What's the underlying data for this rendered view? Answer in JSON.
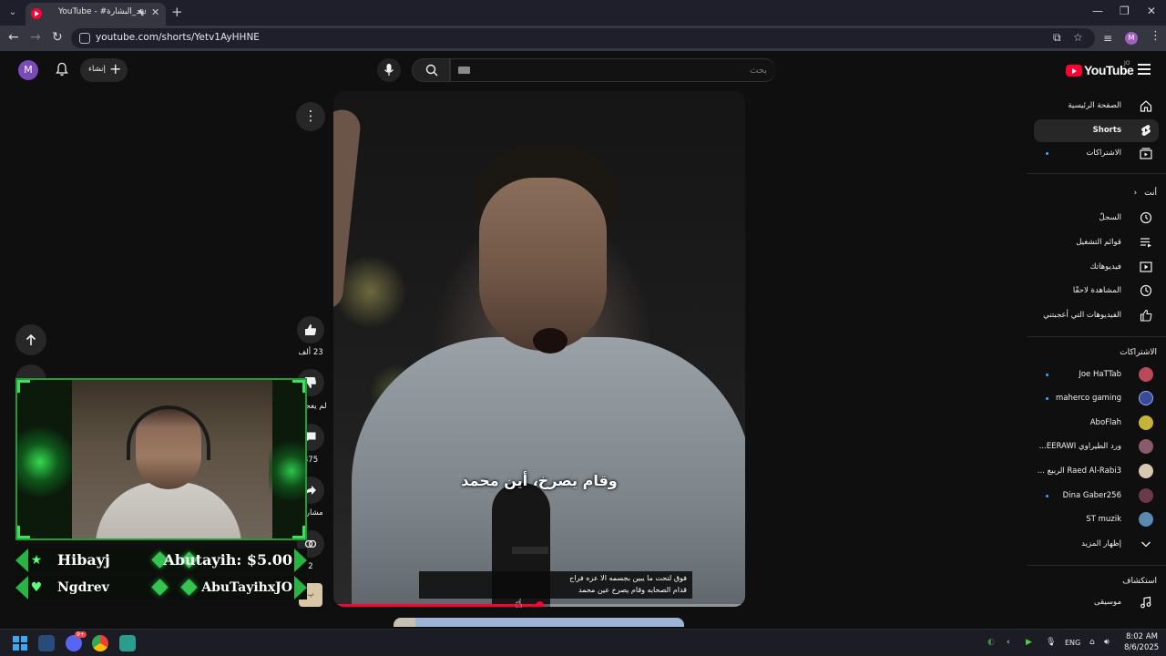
{
  "browser": {
    "tab_title": "YouTube - #فهد_البشارة",
    "tab_audio_icon": "speaker-icon",
    "new_tab_label": "+",
    "url": "youtube.com/shorts/Yetv1AyHHNE",
    "profile_initial": "M"
  },
  "youtube": {
    "logo_text": "YouTube",
    "region": "JO",
    "search_placeholder": "بحث",
    "create_label": "إنشاء",
    "avatar_initial": "M"
  },
  "sidebar": {
    "main": [
      {
        "label": "الصفحة الرئيسية",
        "icon": "home-icon"
      },
      {
        "label": "Shorts",
        "icon": "shorts-icon",
        "active": true
      },
      {
        "label": "الاشتراكات",
        "icon": "subscriptions-icon",
        "dot": true
      }
    ],
    "you_header": "أنت",
    "you": [
      {
        "label": "السجلّ",
        "icon": "history-icon"
      },
      {
        "label": "قوائم التشغيل",
        "icon": "playlists-icon"
      },
      {
        "label": "فيديوهاتك",
        "icon": "your-videos-icon"
      },
      {
        "label": "المشاهدة لاحقًا",
        "icon": "watch-later-icon"
      },
      {
        "label": "الفيديوهات التي أعجبتني",
        "icon": "liked-icon"
      }
    ],
    "subs_header": "الاشتراكات",
    "subscriptions": [
      {
        "label": "Joe HaTTab",
        "dot": true,
        "color": "#b84a5a"
      },
      {
        "label": "maherco gaming",
        "dot": true,
        "color": "#3a4a9a"
      },
      {
        "label": "AboFlah",
        "dot": false,
        "color": "#c7b23a"
      },
      {
        "label": "ورد الطيراوي EERAWI...",
        "dot": false,
        "color": "#8a5a6a"
      },
      {
        "label": "Raed Al-Rabi3 الربيع ...",
        "dot": false,
        "color": "#d8c8b0"
      },
      {
        "label": "Dina Gaber256",
        "dot": true,
        "color": "#6a3a4a"
      },
      {
        "label": "ST muzik",
        "dot": false,
        "color": "#5a8ab0"
      }
    ],
    "show_more": "إظهار المزيد",
    "explore_header": "استكشاف",
    "explore": [
      {
        "label": "موسيقى",
        "icon": "music-icon"
      }
    ]
  },
  "short": {
    "subtitle": "وقام يصرخ، أين محمد",
    "caption_line1": "فوق لتحت ما يبين بجسمه الا عزه فراح",
    "caption_line2": "قدام الصحابه وقام يصرخ عين محمد",
    "progress": 0.5,
    "likes": "23 ألف",
    "dislike_label": "لم يعجبني",
    "comments": "375",
    "share_label": "مشاركة",
    "remix_count": "2",
    "channel_thumb_text": "فهد"
  },
  "stream_overlay": {
    "donations": [
      {
        "left": "Hibayj",
        "right": "Abutayih: $5.00",
        "icon": "star-icon"
      },
      {
        "left": "Ngdrev",
        "right": "AbuTayihxJO",
        "icon": "heart-icon"
      }
    ],
    "accent": "#28b443"
  },
  "taskbar": {
    "lang": "ENG",
    "time": "8:02 AM",
    "date": "8/6/2025",
    "discord_badge": "9+"
  }
}
